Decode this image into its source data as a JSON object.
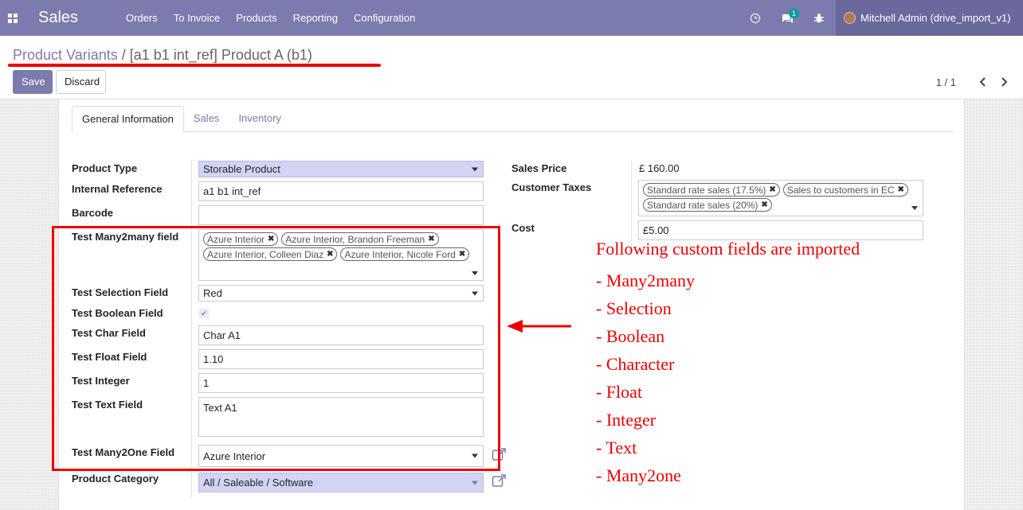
{
  "navbar": {
    "app_name": "Sales",
    "menu": [
      "Orders",
      "To Invoice",
      "Products",
      "Reporting",
      "Configuration"
    ],
    "messages_badge": "1",
    "user": "Mitchell Admin (drive_import_v1)",
    "bg_color": "#7c7bad"
  },
  "control_panel": {
    "breadcrumb_parent": "Product Variants",
    "breadcrumb_separator": "/",
    "breadcrumb_current": "[a1 b1 int_ref] Product A (b1)",
    "save_label": "Save",
    "discard_label": "Discard",
    "pager": "1 / 1"
  },
  "tabs": [
    "General Information",
    "Sales",
    "Inventory"
  ],
  "form": {
    "product_type_label": "Product Type",
    "product_type_value": "Storable Product",
    "internal_reference_label": "Internal Reference",
    "internal_reference_value": "a1 b1 int_ref",
    "barcode_label": "Barcode",
    "barcode_value": "",
    "many2many_label": "Test Many2many field",
    "many2many_tags": [
      "Azure Interior",
      "Azure Interior, Brandon Freeman",
      "Azure Interior, Colleen Diaz",
      "Azure Interior, Nicole Ford"
    ],
    "selection_label": "Test Selection Field",
    "selection_value": "Red",
    "boolean_label": "Test Boolean Field",
    "boolean_value": true,
    "char_label": "Test Char Field",
    "char_value": "Char A1",
    "float_label": "Test Float Field",
    "float_value": "1.10",
    "integer_label": "Test Integer",
    "integer_value": "1",
    "text_label": "Test Text Field",
    "text_value": "Text A1",
    "many2one_label": "Test Many2One Field",
    "many2one_value": "Azure Interior",
    "category_label": "Product Category",
    "category_value": "All / Saleable / Software",
    "sales_price_label": "Sales Price",
    "sales_price_value": "£ 160.00",
    "customer_taxes_label": "Customer Taxes",
    "customer_taxes_tags": [
      "Standard rate sales (17.5%)",
      "Sales to customers in EC",
      "Standard rate sales (20%)"
    ],
    "cost_label": "Cost",
    "cost_value": "£5.00"
  },
  "annotation": {
    "heading": "Following custom fields are imported",
    "items": [
      "- Many2many",
      "- Selection",
      "- Boolean",
      "- Character",
      "- Float",
      "- Integer",
      "- Text",
      "- Many2one"
    ],
    "color": "#e00000"
  }
}
